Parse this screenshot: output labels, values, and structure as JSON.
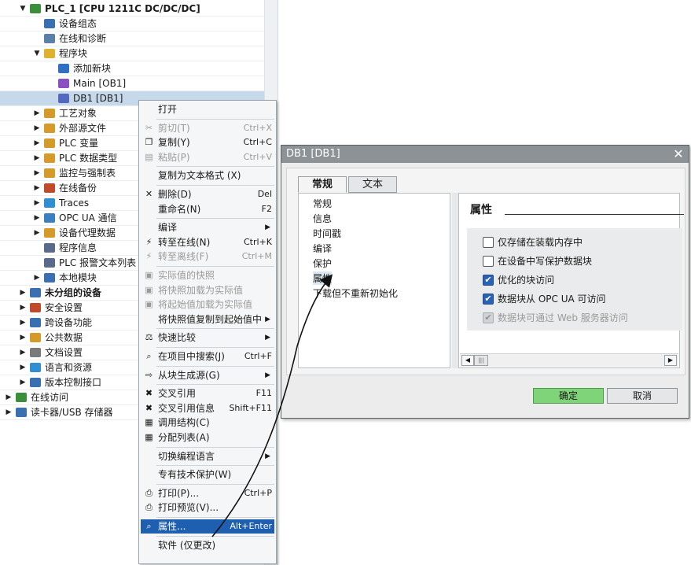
{
  "tree": {
    "items": [
      {
        "label": "PLC_1 [CPU 1211C DC/DC/DC]",
        "expanded": true,
        "bold": true,
        "level": 2,
        "icon": "cpu-icon",
        "color": "#3a8f3a"
      },
      {
        "label": "设备组态",
        "level": 3,
        "icon": "device-config-icon",
        "color": "#3a6fb0"
      },
      {
        "label": "在线和诊断",
        "level": 3,
        "icon": "online-diagnostics-icon",
        "color": "#5a7fa8"
      },
      {
        "label": "程序块",
        "expanded": true,
        "level": 3,
        "icon": "folder-blocks-icon",
        "color": "#e0b030"
      },
      {
        "label": "添加新块",
        "level": 4,
        "icon": "add-block-icon",
        "color": "#2f6fc4"
      },
      {
        "label": "Main [OB1]",
        "level": 4,
        "icon": "ob-block-icon",
        "color": "#8a4fc0"
      },
      {
        "label": "DB1 [DB1]",
        "level": 4,
        "selected": true,
        "icon": "db-block-icon",
        "color": "#5468c0"
      },
      {
        "label": "工艺对象",
        "collapsed": true,
        "level": 3,
        "icon": "technology-objects-icon",
        "color": "#d49a2a"
      },
      {
        "label": "外部源文件",
        "collapsed": true,
        "level": 3,
        "icon": "external-source-icon",
        "color": "#d49a2a"
      },
      {
        "label": "PLC 变量",
        "collapsed": true,
        "level": 3,
        "icon": "plc-tags-icon",
        "color": "#d49a2a"
      },
      {
        "label": "PLC 数据类型",
        "collapsed": true,
        "level": 3,
        "icon": "plc-datatypes-icon",
        "color": "#d49a2a"
      },
      {
        "label": "监控与强制表",
        "collapsed": true,
        "level": 3,
        "icon": "watch-table-icon",
        "color": "#d49a2a"
      },
      {
        "label": "在线备份",
        "collapsed": true,
        "level": 3,
        "icon": "online-backup-icon",
        "color": "#c04a2a"
      },
      {
        "label": "Traces",
        "collapsed": true,
        "level": 3,
        "icon": "traces-icon",
        "color": "#2f8fd0"
      },
      {
        "label": "OPC UA 通信",
        "collapsed": true,
        "level": 3,
        "icon": "opcua-icon",
        "color": "#3a7fc0"
      },
      {
        "label": "设备代理数据",
        "collapsed": true,
        "level": 3,
        "icon": "device-proxy-icon",
        "color": "#d49a2a"
      },
      {
        "label": "程序信息",
        "level": 3,
        "icon": "program-info-icon",
        "color": "#5a6a8a"
      },
      {
        "label": "PLC 报警文本列表",
        "level": 3,
        "icon": "alarm-text-icon",
        "color": "#5a6a8a"
      },
      {
        "label": "本地模块",
        "collapsed": true,
        "level": 3,
        "icon": "local-modules-icon",
        "color": "#3a6fb0"
      },
      {
        "label": "未分组的设备",
        "collapsed": true,
        "bold": true,
        "level": 1,
        "icon": "ungrouped-devices-icon",
        "color": "#3a6fb0"
      },
      {
        "label": "安全设置",
        "collapsed": true,
        "level": 1,
        "icon": "security-icon",
        "color": "#c04a2a"
      },
      {
        "label": "跨设备功能",
        "collapsed": true,
        "level": 1,
        "icon": "cross-device-icon",
        "color": "#3a6fb0"
      },
      {
        "label": "公共数据",
        "collapsed": true,
        "level": 1,
        "icon": "common-data-icon",
        "color": "#d49a2a"
      },
      {
        "label": "文档设置",
        "collapsed": true,
        "level": 1,
        "icon": "document-settings-icon",
        "color": "#7a7a7a"
      },
      {
        "label": "语言和资源",
        "collapsed": true,
        "level": 1,
        "icon": "languages-icon",
        "color": "#2f8fd0"
      },
      {
        "label": "版本控制接口",
        "collapsed": true,
        "level": 1,
        "icon": "version-control-icon",
        "color": "#3a6fb0"
      },
      {
        "label": "在线访问",
        "collapsed": true,
        "level": 0,
        "icon": "online-access-icon",
        "color": "#3a8f3a"
      },
      {
        "label": "读卡器/USB 存储器",
        "collapsed": true,
        "level": 0,
        "icon": "card-reader-icon",
        "color": "#3a6fb0"
      }
    ]
  },
  "context_menu": {
    "items": [
      {
        "type": "item",
        "label": "打开"
      },
      {
        "type": "sep"
      },
      {
        "type": "item",
        "label": "剪切(T)",
        "shortcut": "Ctrl+X",
        "disabled": true,
        "icon": "cut-icon",
        "glyph": "✂"
      },
      {
        "type": "item",
        "label": "复制(Y)",
        "shortcut": "Ctrl+C",
        "icon": "copy-icon",
        "glyph": "❐"
      },
      {
        "type": "item",
        "label": "粘贴(P)",
        "shortcut": "Ctrl+V",
        "disabled": true,
        "icon": "paste-icon",
        "glyph": "▤"
      },
      {
        "type": "sep"
      },
      {
        "type": "item",
        "label": "复制为文本格式 (X)"
      },
      {
        "type": "sep"
      },
      {
        "type": "item",
        "label": "删除(D)",
        "shortcut": "Del",
        "icon": "delete-icon",
        "glyph": "✕"
      },
      {
        "type": "item",
        "label": "重命名(N)",
        "shortcut": "F2"
      },
      {
        "type": "sep"
      },
      {
        "type": "item",
        "label": "编译",
        "submenu": true
      },
      {
        "type": "item",
        "label": "转至在线(N)",
        "shortcut": "Ctrl+K",
        "icon": "go-online-icon",
        "glyph": "⚡"
      },
      {
        "type": "item",
        "label": "转至离线(F)",
        "shortcut": "Ctrl+M",
        "disabled": true,
        "icon": "go-offline-icon",
        "glyph": "⚡"
      },
      {
        "type": "sep"
      },
      {
        "type": "item",
        "label": "实际值的快照",
        "disabled": true,
        "icon": "snapshot-icon",
        "glyph": "▣"
      },
      {
        "type": "item",
        "label": "将快照加载为实际值",
        "disabled": true,
        "icon": "load-snapshot-icon",
        "glyph": "▣"
      },
      {
        "type": "item",
        "label": "将起始值加载为实际值",
        "disabled": true,
        "icon": "load-start-values-icon",
        "glyph": "▣"
      },
      {
        "type": "item",
        "label": "将快照值复制到起始值中",
        "submenu": true
      },
      {
        "type": "sep"
      },
      {
        "type": "item",
        "label": "快速比较",
        "submenu": true,
        "icon": "compare-icon",
        "glyph": "⚖"
      },
      {
        "type": "sep"
      },
      {
        "type": "item",
        "label": "在项目中搜索(J)",
        "shortcut": "Ctrl+F",
        "icon": "search-project-icon",
        "glyph": "⌕"
      },
      {
        "type": "sep"
      },
      {
        "type": "item",
        "label": "从块生成源(G)",
        "submenu": true,
        "icon": "generate-source-icon",
        "glyph": "⇨"
      },
      {
        "type": "sep"
      },
      {
        "type": "item",
        "label": "交叉引用",
        "shortcut": "F11",
        "icon": "cross-reference-icon",
        "glyph": "✖"
      },
      {
        "type": "item",
        "label": "交叉引用信息",
        "shortcut": "Shift+F11",
        "icon": "cross-reference-info-icon",
        "glyph": "✖"
      },
      {
        "type": "item",
        "label": "调用结构(C)",
        "icon": "call-structure-icon",
        "glyph": "▦"
      },
      {
        "type": "item",
        "label": "分配列表(A)",
        "icon": "assignment-list-icon",
        "glyph": "▦"
      },
      {
        "type": "sep"
      },
      {
        "type": "item",
        "label": "切换编程语言",
        "submenu": true
      },
      {
        "type": "sep"
      },
      {
        "type": "item",
        "label": "专有技术保护(W)"
      },
      {
        "type": "sep"
      },
      {
        "type": "item",
        "label": "打印(P)...",
        "shortcut": "Ctrl+P",
        "icon": "print-icon",
        "glyph": "⎙"
      },
      {
        "type": "item",
        "label": "打印预览(V)...",
        "icon": "print-preview-icon",
        "glyph": "⎙"
      },
      {
        "type": "sep"
      },
      {
        "type": "item",
        "label": "属性...",
        "shortcut": "Alt+Enter",
        "highlight": true,
        "icon": "properties-icon",
        "glyph": "⌕"
      },
      {
        "type": "sep"
      },
      {
        "type": "item",
        "label": "软件 (仅更改)"
      }
    ]
  },
  "dialog": {
    "title": "DB1 [DB1]",
    "close_glyph": "✕",
    "tabs": [
      "常规",
      "文本"
    ],
    "nav": [
      "常规",
      "信息",
      "时间戳",
      "编译",
      "保护",
      "属性",
      "下载但不重新初始化"
    ],
    "selected_nav": "属性",
    "section_title": "属性",
    "options": [
      {
        "label": "仅存储在装载内存中",
        "checked": false,
        "disabled": false
      },
      {
        "label": "在设备中写保护数据块",
        "checked": false,
        "disabled": false
      },
      {
        "label": "优化的块访问",
        "checked": true,
        "disabled": false
      },
      {
        "label": "数据块从 OPC UA 可访问",
        "checked": true,
        "disabled": false
      },
      {
        "label": "数据块可通过 Web 服务器访问",
        "checked": true,
        "disabled": true
      }
    ],
    "scroll_left": "◀",
    "scroll_thumb": "|||",
    "scroll_right": "▶",
    "ok_label": "确定",
    "cancel_label": "取消"
  },
  "colors": {
    "selection": "#c6d9ea",
    "menu_highlight": "#1f5fb0",
    "ok_button": "#7fd47a",
    "checkbox_checked": "#2b62b4"
  }
}
